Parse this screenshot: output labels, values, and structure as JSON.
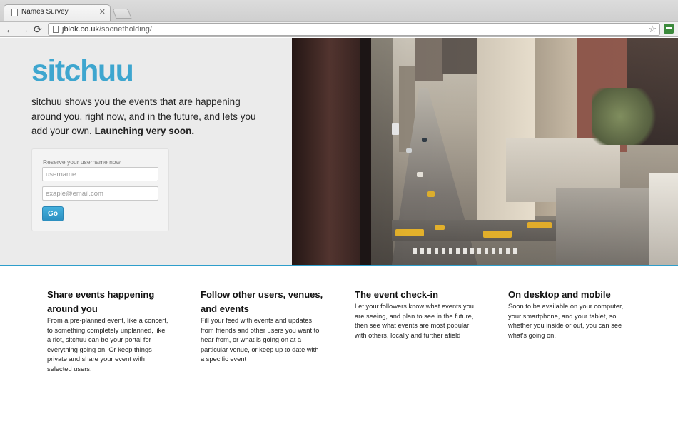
{
  "browser": {
    "tab_title": "Names Survey",
    "tab_close": "✕",
    "nav": {
      "back": "←",
      "forward": "→",
      "reload": "⟳"
    },
    "url_host": "jblok.co.uk",
    "url_path": "/socnetholding/",
    "bookmark_icon": "☆"
  },
  "hero": {
    "logo": "sitchuu",
    "tagline": "sitchuu shows you the events that are happening around you, right now, and in the future, and lets you add your own.",
    "tagline_strong": "Launching very soon.",
    "form": {
      "label": "Reserve your username now",
      "username_placeholder": "username",
      "email_placeholder": "exaple@email.com",
      "submit_label": "Go"
    }
  },
  "features": [
    {
      "title": "Share events happening around you",
      "body": "From a pre-planned event, like a concert, to something completely unplanned, like a riot, sitchuu can be your portal for everything going on. Or keep things private and share your event with selected users."
    },
    {
      "title": "Follow other users, venues, and events",
      "body": "Fill your feed with events and updates from friends and other users you want to hear from, or what is going on at a particular venue, or keep up to date with a specific event"
    },
    {
      "title": "The event check-in",
      "body": "Let your followers know what events you are seeing, and plan to see in the future, then see what events are most popular with others, locally and further afield"
    },
    {
      "title": "On desktop and mobile",
      "body": "Soon to be available on your computer, your smartphone, and your tablet, so whether you inside or out, you can see what's going on."
    }
  ],
  "colors": {
    "brand": "#3ea6cf",
    "accent_rule": "#2e9ecb",
    "button": "#2c8fc0"
  }
}
